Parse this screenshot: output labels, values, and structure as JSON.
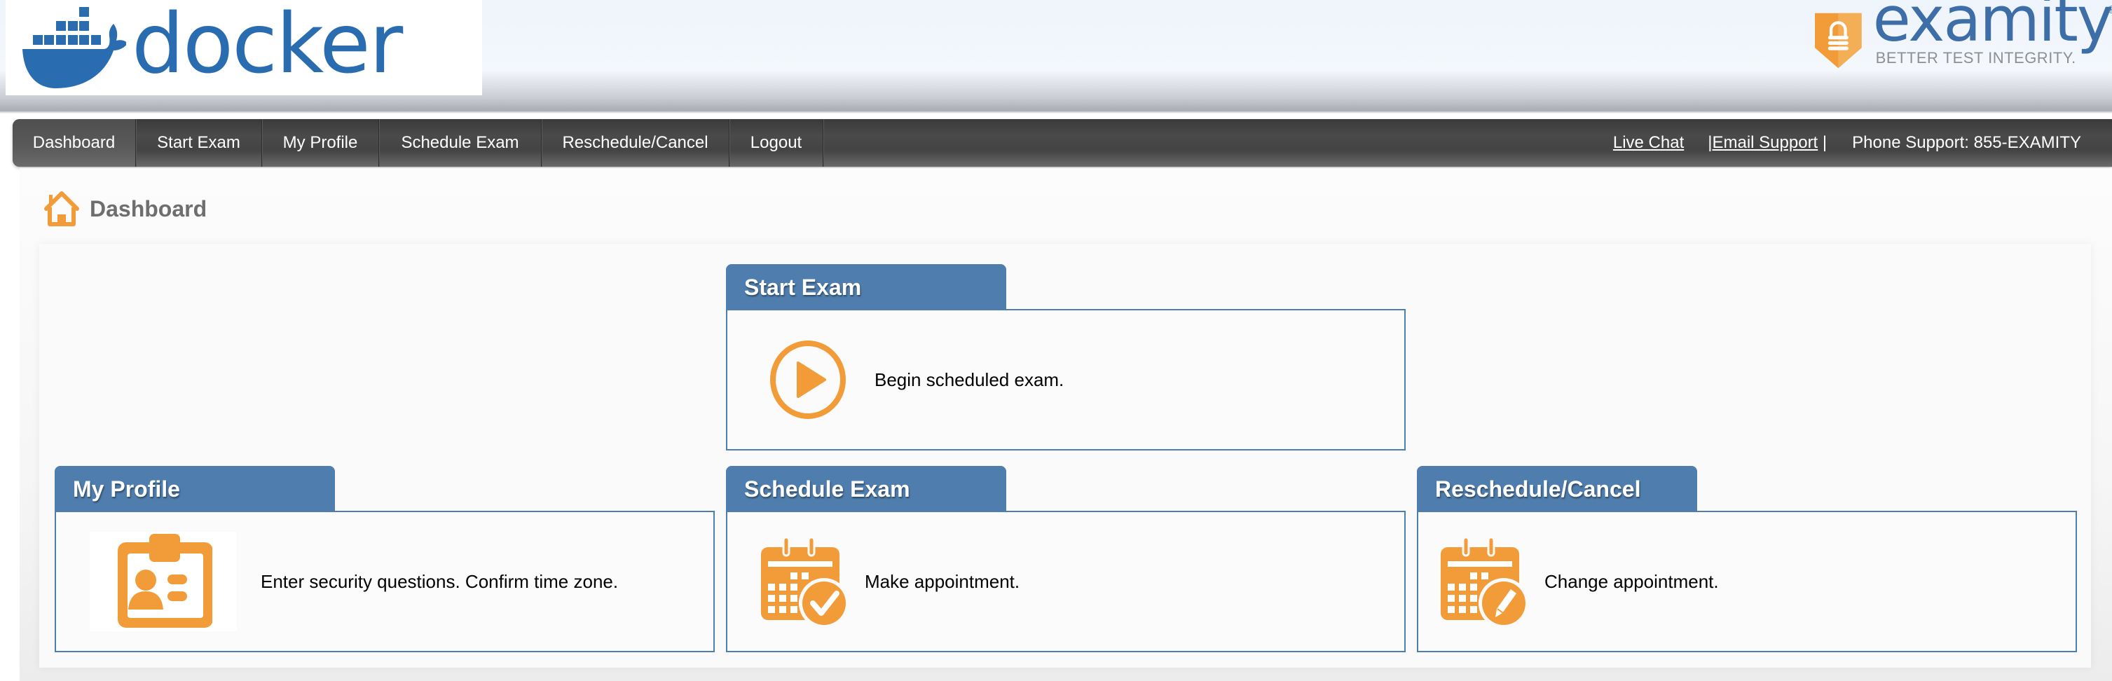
{
  "header": {
    "left_logo": {
      "icon": "docker-whale-icon",
      "text": "docker"
    },
    "right_logo": {
      "icon": "examity-shield-lock-icon",
      "text": "examity",
      "registered_mark": "®",
      "tagline": "BETTER TEST INTEGRITY."
    }
  },
  "navbar": {
    "items": [
      {
        "label": "Dashboard",
        "active": true
      },
      {
        "label": "Start Exam",
        "active": false
      },
      {
        "label": "My Profile",
        "active": false
      },
      {
        "label": "Schedule Exam",
        "active": false
      },
      {
        "label": "Reschedule/Cancel",
        "active": false
      },
      {
        "label": "Logout",
        "active": false
      }
    ],
    "right": {
      "live_chat": "Live Chat",
      "sep1": "|",
      "email_support": "Email Support",
      "sep2": " |",
      "phone_support": "Phone Support: 855-EXAMITY"
    }
  },
  "page": {
    "title": "Dashboard",
    "title_icon": "home-icon"
  },
  "cards": [
    {
      "id": "start-exam",
      "title": "Start Exam",
      "description": "Begin scheduled exam.",
      "icon": "play-circle-icon"
    },
    {
      "id": "my-profile",
      "title": "My Profile",
      "description": "Enter security questions. Confirm time zone.",
      "icon": "id-badge-icon"
    },
    {
      "id": "schedule-exam",
      "title": "Schedule Exam",
      "description": "Make appointment.",
      "icon": "calendar-check-icon"
    },
    {
      "id": "reschedule-cancel",
      "title": "Reschedule/Cancel",
      "description": "Change appointment.",
      "icon": "calendar-edit-icon"
    }
  ],
  "colors": {
    "accent_orange": "#f19c38",
    "card_blue": "#4f7eae",
    "docker_blue": "#2a6cb0",
    "examity_blue": "#3e6ea8",
    "navbar_dark": "#434343"
  }
}
